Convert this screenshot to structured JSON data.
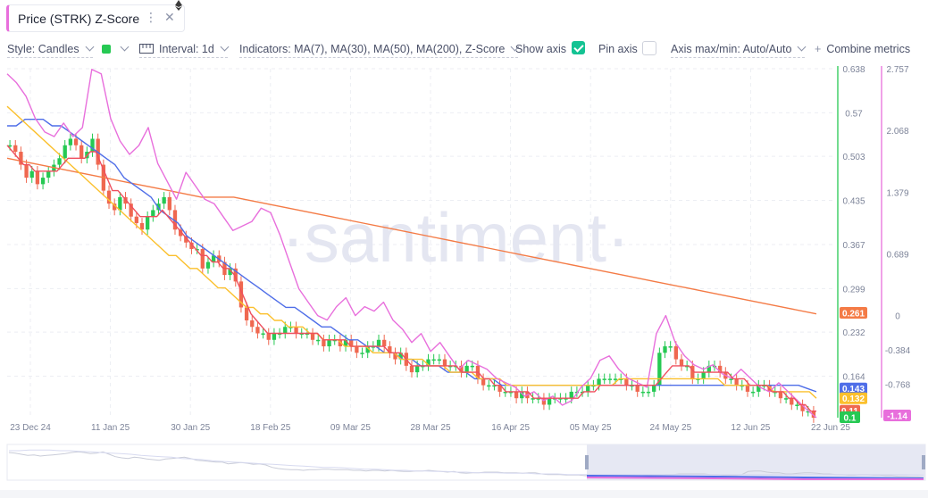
{
  "tab": {
    "title": "Price (STRK) Z-Score",
    "menu_icon": "vertical-dots-icon",
    "close_icon": "close-icon"
  },
  "toolbar": {
    "style_label": "Style: Candles",
    "color_value": "#26c953",
    "interval_label": "Interval: 1d",
    "indicators_label": "Indicators: MA(7), MA(30), MA(50), MA(200), Z-Score",
    "show_axis_label": "Show axis",
    "show_axis_checked": true,
    "pin_axis_label": "Pin axis",
    "pin_axis_checked": false,
    "axis_label": "Axis max/min: Auto/Auto",
    "combine_label": "Combine metrics"
  },
  "watermark": "·santiment·",
  "colors": {
    "up": "#26c953",
    "down": "#ef6850",
    "ma7": "#ef4f5e",
    "ma30": "#fbc02d",
    "ma50": "#4f6ee8",
    "ma200": "#f47b46",
    "zscore": "#e86fdc"
  },
  "chart_data": {
    "type": "line",
    "x_ticks": [
      "23 Dec 24",
      "11 Jan 25",
      "30 Jan 25",
      "18 Feb 25",
      "09 Mar 25",
      "28 Mar 25",
      "16 Apr 25",
      "05 May 25",
      "24 May 25",
      "12 Jun 25",
      "22 Jun 25"
    ],
    "price_axis": {
      "ticks": [
        "0.638",
        "0.57",
        "0.503",
        "0.435",
        "0.367",
        "0.299",
        "0.232",
        "0.164"
      ],
      "min": 0.1,
      "max": 0.638
    },
    "zscore_axis": {
      "ticks": [
        "2.757",
        "2.068",
        "1.379",
        "0.689",
        "0",
        "-0.384",
        "-0.768"
      ],
      "min": -1.14,
      "max": 2.757
    },
    "last_values": {
      "ma50": "0.143",
      "ma30": "0.132",
      "price": "0.11",
      "ma7": "0.1",
      "zscore": "-1.14",
      "ma200": "0.261"
    },
    "price_close": [
      0.52,
      0.51,
      0.49,
      0.47,
      0.48,
      0.46,
      0.47,
      0.48,
      0.49,
      0.5,
      0.52,
      0.53,
      0.52,
      0.5,
      0.51,
      0.53,
      0.49,
      0.45,
      0.43,
      0.42,
      0.44,
      0.43,
      0.41,
      0.4,
      0.39,
      0.41,
      0.42,
      0.43,
      0.44,
      0.42,
      0.39,
      0.38,
      0.37,
      0.36,
      0.36,
      0.33,
      0.34,
      0.35,
      0.34,
      0.32,
      0.33,
      0.31,
      0.27,
      0.25,
      0.24,
      0.23,
      0.23,
      0.22,
      0.23,
      0.23,
      0.24,
      0.24,
      0.23,
      0.23,
      0.23,
      0.22,
      0.22,
      0.21,
      0.22,
      0.22,
      0.21,
      0.22,
      0.21,
      0.2,
      0.2,
      0.21,
      0.21,
      0.22,
      0.21,
      0.2,
      0.19,
      0.2,
      0.18,
      0.17,
      0.18,
      0.18,
      0.19,
      0.19,
      0.19,
      0.18,
      0.18,
      0.18,
      0.17,
      0.18,
      0.18,
      0.16,
      0.15,
      0.15,
      0.15,
      0.14,
      0.14,
      0.14,
      0.13,
      0.14,
      0.13,
      0.13,
      0.13,
      0.12,
      0.13,
      0.13,
      0.13,
      0.13,
      0.14,
      0.14,
      0.14,
      0.15,
      0.15,
      0.16,
      0.16,
      0.16,
      0.16,
      0.16,
      0.15,
      0.15,
      0.14,
      0.14,
      0.14,
      0.15,
      0.2,
      0.21,
      0.21,
      0.19,
      0.18,
      0.18,
      0.16,
      0.16,
      0.17,
      0.18,
      0.18,
      0.17,
      0.16,
      0.16,
      0.15,
      0.15,
      0.14,
      0.14,
      0.15,
      0.15,
      0.14,
      0.14,
      0.13,
      0.13,
      0.12,
      0.12,
      0.11,
      0.11,
      0.1
    ],
    "ma7": [
      0.52,
      0.51,
      0.5,
      0.49,
      0.49,
      0.48,
      0.48,
      0.48,
      0.48,
      0.48,
      0.49,
      0.5,
      0.5,
      0.5,
      0.5,
      0.51,
      0.51,
      0.49,
      0.47,
      0.45,
      0.45,
      0.44,
      0.43,
      0.42,
      0.41,
      0.41,
      0.41,
      0.41,
      0.42,
      0.41,
      0.4,
      0.39,
      0.38,
      0.37,
      0.36,
      0.35,
      0.35,
      0.34,
      0.34,
      0.33,
      0.33,
      0.32,
      0.3,
      0.28,
      0.26,
      0.25,
      0.24,
      0.23,
      0.23,
      0.23,
      0.23,
      0.23,
      0.23,
      0.23,
      0.23,
      0.23,
      0.23,
      0.22,
      0.22,
      0.22,
      0.22,
      0.22,
      0.21,
      0.21,
      0.21,
      0.21,
      0.21,
      0.21,
      0.21,
      0.2,
      0.2,
      0.2,
      0.19,
      0.18,
      0.18,
      0.18,
      0.18,
      0.18,
      0.18,
      0.18,
      0.18,
      0.18,
      0.17,
      0.17,
      0.17,
      0.17,
      0.16,
      0.16,
      0.15,
      0.15,
      0.14,
      0.14,
      0.14,
      0.14,
      0.14,
      0.13,
      0.13,
      0.13,
      0.13,
      0.13,
      0.13,
      0.13,
      0.13,
      0.13,
      0.14,
      0.14,
      0.14,
      0.15,
      0.15,
      0.15,
      0.15,
      0.15,
      0.15,
      0.15,
      0.15,
      0.15,
      0.15,
      0.15,
      0.16,
      0.17,
      0.18,
      0.18,
      0.18,
      0.18,
      0.17,
      0.17,
      0.17,
      0.17,
      0.17,
      0.17,
      0.17,
      0.16,
      0.16,
      0.16,
      0.15,
      0.15,
      0.15,
      0.15,
      0.14,
      0.14,
      0.14,
      0.13,
      0.13,
      0.12,
      0.12,
      0.11,
      0.11
    ],
    "ma30": [
      0.58,
      0.57,
      0.56,
      0.55,
      0.54,
      0.53,
      0.52,
      0.51,
      0.5,
      0.49,
      0.48,
      0.47,
      0.46,
      0.45,
      0.44,
      0.43,
      0.42,
      0.41,
      0.4,
      0.39,
      0.38,
      0.37,
      0.36,
      0.35,
      0.35,
      0.34,
      0.33,
      0.33,
      0.32,
      0.31,
      0.3,
      0.3,
      0.29,
      0.28,
      0.27,
      0.27,
      0.26,
      0.26,
      0.25,
      0.25,
      0.24,
      0.24,
      0.24,
      0.23,
      0.23,
      0.22,
      0.22,
      0.22,
      0.21,
      0.21,
      0.21,
      0.21,
      0.2,
      0.2,
      0.2,
      0.2,
      0.19,
      0.19,
      0.19,
      0.19,
      0.18,
      0.18,
      0.18,
      0.17,
      0.17,
      0.17,
      0.17,
      0.16,
      0.16,
      0.16,
      0.16,
      0.15,
      0.15,
      0.15,
      0.15,
      0.15,
      0.15,
      0.15,
      0.15,
      0.15,
      0.15,
      0.15,
      0.15,
      0.15,
      0.15,
      0.15,
      0.15,
      0.16,
      0.16,
      0.16,
      0.16,
      0.16,
      0.16,
      0.16,
      0.16,
      0.16,
      0.16,
      0.16,
      0.16,
      0.16,
      0.16,
      0.16,
      0.15,
      0.15,
      0.15,
      0.15,
      0.15,
      0.15,
      0.15,
      0.14,
      0.14,
      0.14,
      0.14,
      0.14,
      0.14,
      0.13
    ],
    "ma50": [
      0.55,
      0.55,
      0.56,
      0.56,
      0.56,
      0.55,
      0.55,
      0.54,
      0.53,
      0.52,
      0.51,
      0.5,
      0.49,
      0.47,
      0.46,
      0.45,
      0.44,
      0.42,
      0.41,
      0.4,
      0.38,
      0.37,
      0.36,
      0.35,
      0.34,
      0.33,
      0.32,
      0.31,
      0.3,
      0.29,
      0.28,
      0.27,
      0.27,
      0.26,
      0.25,
      0.24,
      0.24,
      0.23,
      0.22,
      0.22,
      0.21,
      0.21,
      0.2,
      0.2,
      0.19,
      0.19,
      0.18,
      0.18,
      0.18,
      0.17,
      0.17,
      0.17,
      0.16,
      0.16,
      0.16,
      0.15,
      0.15,
      0.15,
      0.15,
      0.15,
      0.15,
      0.15,
      0.15,
      0.15,
      0.15,
      0.15,
      0.15,
      0.15,
      0.15,
      0.15,
      0.15,
      0.15,
      0.15,
      0.15,
      0.15,
      0.15,
      0.15,
      0.15,
      0.15,
      0.15,
      0.15,
      0.15,
      0.15,
      0.15,
      0.15,
      0.15,
      0.15,
      0.15,
      0.15,
      0.145,
      0.14
    ],
    "ma200": [
      0.5,
      0.49,
      0.48,
      0.47,
      0.46,
      0.45,
      0.44,
      0.44,
      0.43,
      0.42,
      0.41,
      0.4,
      0.39,
      0.38,
      0.37,
      0.36,
      0.35,
      0.34,
      0.33,
      0.32,
      0.31,
      0.3,
      0.29,
      0.28,
      0.27,
      0.26
    ],
    "zscore": [
      2.7,
      2.6,
      2.45,
      2.2,
      2.05,
      2.0,
      2.15,
      2.0,
      2.1,
      2.75,
      2.7,
      2.2,
      1.95,
      1.8,
      1.9,
      2.1,
      1.7,
      1.5,
      1.3,
      1.6,
      1.45,
      1.3,
      1.25,
      1.1,
      0.95,
      1.0,
      1.05,
      1.2,
      1.15,
      0.9,
      0.6,
      0.3,
      0.15,
      0.0,
      -0.05,
      0.1,
      0.2,
      0.0,
      0.1,
      0.05,
      0.15,
      -0.05,
      -0.15,
      -0.3,
      -0.2,
      -0.4,
      -0.3,
      -0.45,
      -0.6,
      -0.5,
      -0.55,
      -0.6,
      -0.7,
      -0.75,
      -0.8,
      -0.9,
      -0.85,
      -0.95,
      -0.9,
      -1.0,
      -0.95,
      -0.8,
      -0.7,
      -0.5,
      -0.45,
      -0.6,
      -0.7,
      -0.75,
      -0.8,
      -0.2,
      0.0,
      -0.3,
      -0.45,
      -0.55,
      -0.6,
      -0.55,
      -0.65,
      -0.7,
      -0.6,
      -0.7,
      -0.8,
      -0.85,
      -0.75,
      -0.85,
      -0.95,
      -1.05,
      -1.14
    ]
  }
}
